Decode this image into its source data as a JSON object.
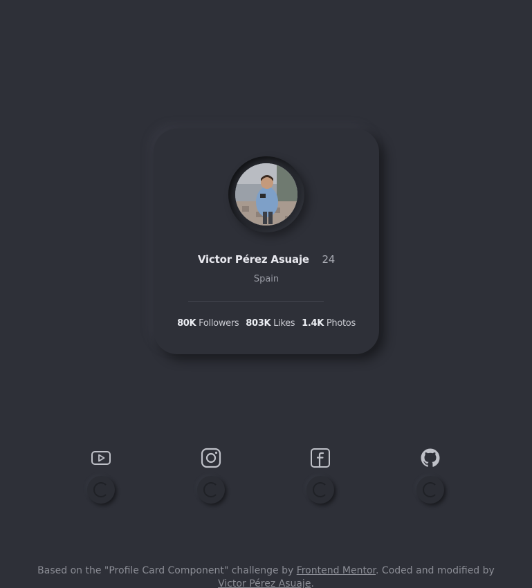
{
  "profile": {
    "name": "Victor Pérez Asuaje",
    "age": "24",
    "location": "Spain",
    "stats": [
      {
        "value": "80K",
        "label": "Followers"
      },
      {
        "value": "803K",
        "label": "Likes"
      },
      {
        "value": "1.4K",
        "label": "Photos"
      }
    ]
  },
  "social": [
    {
      "icon": "youtube-icon"
    },
    {
      "icon": "instagram-icon"
    },
    {
      "icon": "facebook-icon"
    },
    {
      "icon": "github-icon"
    }
  ],
  "footer": {
    "prefix": "Based on the \"Profile Card Component\" challenge by ",
    "link1": "Frontend Mentor",
    "middle": ". Coded and modified by ",
    "link2": "Victor Pérez Asuaje",
    "suffix": "."
  },
  "colors": {
    "background": "#2e3038",
    "text_primary": "#e8e8ee",
    "text_secondary": "#9a9ca5",
    "icon": "#bfc1c8"
  }
}
